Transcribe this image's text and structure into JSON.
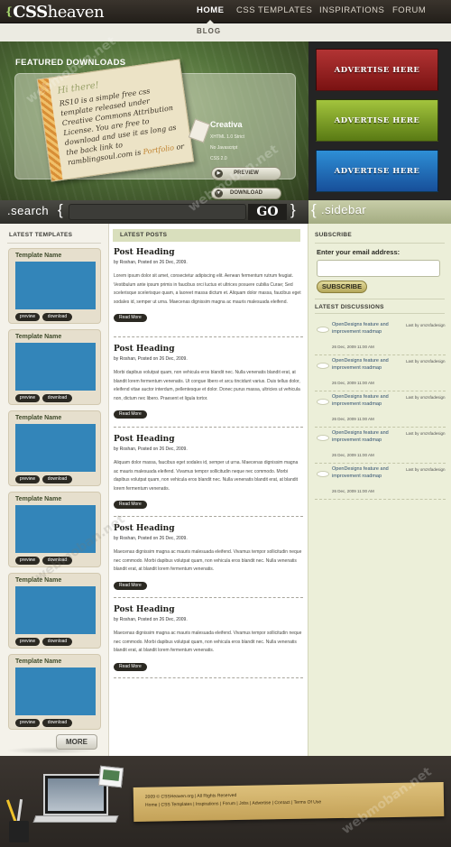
{
  "header": {
    "logo": {
      "mark": "{",
      "part1": "CSS",
      "part2": "heaven"
    },
    "nav": [
      {
        "label": "HOME",
        "active": true
      },
      {
        "label": "CSS TEMPLATES",
        "active": false
      },
      {
        "label": "INSPIRATIONS",
        "active": false
      },
      {
        "label": "FORUM",
        "active": false
      }
    ],
    "subnav": "BLOG"
  },
  "featured": {
    "title": "FEATURED DOWNLOADS",
    "paper_hi": "Hi there!",
    "paper_text": "RS10 is a simple free css template released under Creative Commons Attribution License. You are free to download and use it as long as the back link to ramblingsoul.com is",
    "paper_link": "Portfolio",
    "paper_tail": "or",
    "name": "Creativa",
    "meta1": "XHTML 1.0 Strict",
    "meta2": "No Javascript",
    "meta3": "CSS 2.0",
    "preview_label": "PREVIEW",
    "download_label": "DOWNLOAD",
    "preview_icon": "play-icon",
    "download_icon": "arrow-down-icon"
  },
  "ads": [
    "ADVERTISE HERE",
    "ADVERTISE HERE",
    "ADVERTISE HERE"
  ],
  "search": {
    "label": ".search",
    "open_brace": "{",
    "close_brace": "}",
    "value": "",
    "button": "GO"
  },
  "sidebar_label": {
    "brace": "{",
    "text": ".sidebar"
  },
  "templates": {
    "heading": "LATEST TEMPLATES",
    "items": [
      {
        "name": "Template Name",
        "preview": "preview",
        "download": "download"
      },
      {
        "name": "Template Name",
        "preview": "preview",
        "download": "download"
      },
      {
        "name": "Template Name",
        "preview": "preview",
        "download": "download"
      },
      {
        "name": "Template Name",
        "preview": "preview",
        "download": "download"
      },
      {
        "name": "Template Name",
        "preview": "preview",
        "download": "download"
      },
      {
        "name": "Template Name",
        "preview": "preview",
        "download": "download"
      }
    ],
    "more": "MORE"
  },
  "posts": {
    "heading": "LATEST POSTS",
    "items": [
      {
        "title": "Post Heading",
        "meta": "by Roshan, Posted on 26 Dec, 2009.",
        "body": "Lorem ipsum dolor sit amet, consectetur adipiscing elit. Aenean fermentum rutrum feugiat. Vestibulum ante ipsum primis in faucibus orci luctus et ultrices posuere cubilia Curae; Sed scelerisque scelerisque quam, a laoreet massa dictum et. Aliquam dolor massa, faucibus eget sodales id, semper ut urna. Maecenas dignissim magna ac mauris malesuada eleifend.",
        "read_more": "Read More"
      },
      {
        "title": "Post Heading",
        "meta": "by Roshan, Posted on 26 Dec, 2009.",
        "body": "Morbi dapibus volutpat quam, non vehicula eros blandit nec. Nulla venenatis blandit erat, at blandit lorem fermentum venenatis. Ut congue libero et arcu tincidunt varius. Duis tellus dolor, eleifend vitae auctor interdum, pellentesque et dolor. Donec purus massa, ultricies ut vehicula non, dictum nec libero. Praesent et ligula tortor.",
        "read_more": "Read More"
      },
      {
        "title": "Post Heading",
        "meta": "by Roshan, Posted on 26 Dec, 2009.",
        "body": "Aliquam dolor massa, faucibus eget sodales id, semper ut urna. Maecenas dignissim magna ac mauris malesuada eleifend. Vivamus tempor sollicitudin neque nec commodo. Morbi dapibus volutpat quam, non vehicula eros blandit nec. Nulla venenatis blandit erat, at blandit lorem fermentum venenatis.",
        "read_more": "Read More"
      },
      {
        "title": "Post Heading",
        "meta": "by Roshan, Posted on 26 Dec, 2009.",
        "body": "Maecenas dignissim magna ac mauris malesuada eleifend. Vivamus tempor sollicitudin neque nec commodo. Morbi dapibus volutpat quam, non vehicula eros blandit nec. Nulla venenatis blandit erat, at blandit lorem fermentum venenatis.",
        "read_more": "Read More"
      },
      {
        "title": "Post Heading",
        "meta": "by Roshan, Posted on 26 Dec, 2009.",
        "body": "Maecenas dignissim magna ac mauris malesuada eleifend. Vivamus tempor sollicitudin neque nec commodo. Morbi dapibus volutpat quam, non vehicula eros blandit nec. Nulla venenatis blandit erat, at blandit lorem fermentum venenatis.",
        "read_more": "Read More"
      }
    ]
  },
  "sidebar": {
    "subscribe_heading": "SUBSCRIBE",
    "email_label": "Enter your email address:",
    "email_value": "",
    "subscribe_button": "SUBSCRIBE",
    "discussions_heading": "LATEST DISCUSSIONS",
    "discussions": [
      {
        "title": "OpenDesigns feature and improvement roadmap",
        "date": "26 Dec, 2009 11:00 AM",
        "by": "Last by omzsfadesign"
      },
      {
        "title": "OpenDesigns feature and improvement roadmap",
        "date": "26 Dec, 2009 11:00 AM",
        "by": "Last by omzsfadesign"
      },
      {
        "title": "OpenDesigns feature and improvement roadmap",
        "date": "26 Dec, 2009 11:00 AM",
        "by": "Last by omzsfadesign"
      },
      {
        "title": "OpenDesigns feature and improvement roadmap",
        "date": "26 Dec, 2009 11:00 AM",
        "by": "Last by omzsfadesign"
      },
      {
        "title": "OpenDesigns feature and improvement roadmap",
        "date": "26 Dec, 2009 11:00 AM",
        "by": "Last by omzsfadesign"
      }
    ]
  },
  "footer": {
    "copyright": "2009 © CSSHeaven.org | All Rights Reserved",
    "links": [
      "Home",
      "CSS Templates",
      "Inspirations",
      "Forum",
      "Jobs",
      "Advertise",
      "Contact",
      "Terms Of Use"
    ],
    "separator": " | "
  },
  "watermark": "webmoban.net",
  "colors": {
    "accent_green": "#a6d66c",
    "template_thumb": "#3385b9",
    "dark": "#2b2922"
  }
}
